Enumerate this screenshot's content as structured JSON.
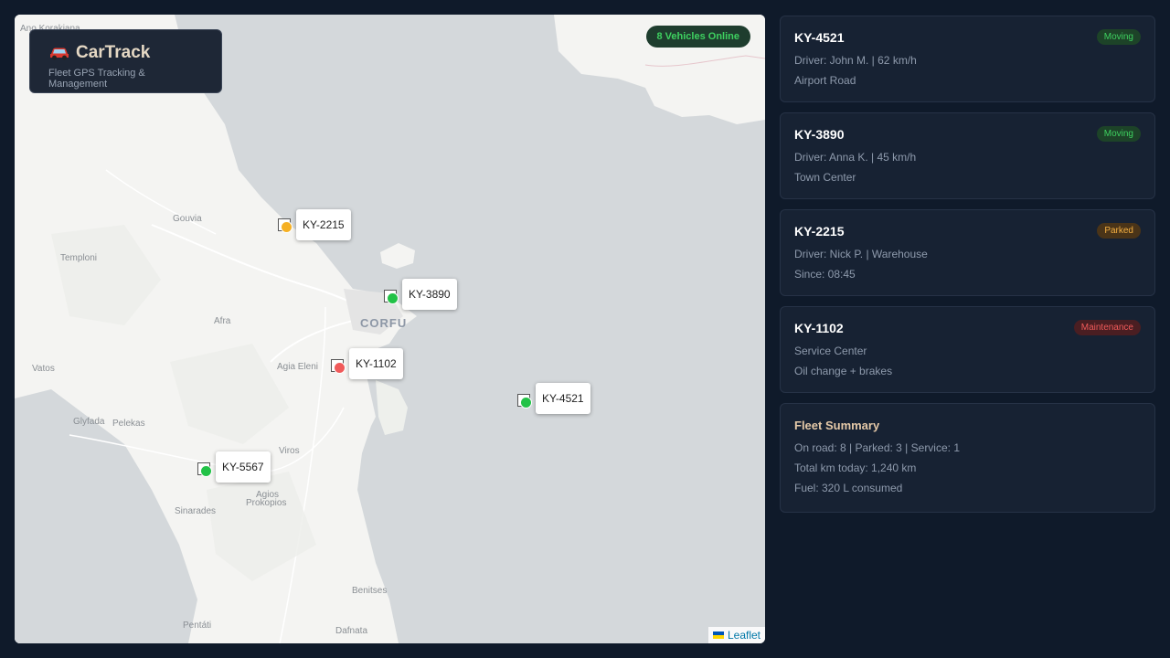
{
  "brand": {
    "name": "CarTrack",
    "subtitle": "Fleet GPS Tracking & Management"
  },
  "map": {
    "online": "8 Vehicles Online",
    "attribution": "Leaflet",
    "places": {
      "ano": "Ano Korakiana",
      "gouvia": "Gouvia",
      "temploni": "Temploni",
      "afra": "Afra",
      "corfu": "CORFU",
      "vatos": "Vatos",
      "agia_eleni": "Agia Eleni",
      "glyfada": "Glyfada",
      "pelekas": "Pelekas",
      "viros": "Viros",
      "agios": "Agios",
      "prokopios": "Prokopios",
      "sinarades": "Sinarades",
      "benitses": "Benitses",
      "pentati": "Pentáti",
      "dafnata": "Dafnata"
    },
    "markers": [
      {
        "id": "KY-2215",
        "status_color": "#f5b024"
      },
      {
        "id": "KY-3890",
        "status_color": "#22c247"
      },
      {
        "id": "KY-1102",
        "status_color": "#f05a5a"
      },
      {
        "id": "KY-4521",
        "status_color": "#22c247"
      },
      {
        "id": "KY-5567",
        "status_color": "#22c247"
      }
    ]
  },
  "vehicles": [
    {
      "id": "KY-4521",
      "status": "Moving",
      "line1": "Driver: John M. | 62 km/h",
      "line2": "Airport Road"
    },
    {
      "id": "KY-3890",
      "status": "Moving",
      "line1": "Driver: Anna K. | 45 km/h",
      "line2": "Town Center"
    },
    {
      "id": "KY-2215",
      "status": "Parked",
      "line1": "Driver: Nick P. | Warehouse",
      "line2": "Since: 08:45"
    },
    {
      "id": "KY-1102",
      "status": "Maintenance",
      "line1": "Service Center",
      "line2": "Oil change + brakes"
    }
  ],
  "summary": {
    "title": "Fleet Summary",
    "line1": "On road: 8 | Parked: 3 | Service: 1",
    "line2": "Total km today: 1,240 km",
    "line3": "Fuel: 320 L consumed"
  },
  "colors": {
    "moving": "#3ed160",
    "parked": "#f5b042",
    "maintenance": "#f05a5a",
    "accent": "#e5d8c4"
  }
}
